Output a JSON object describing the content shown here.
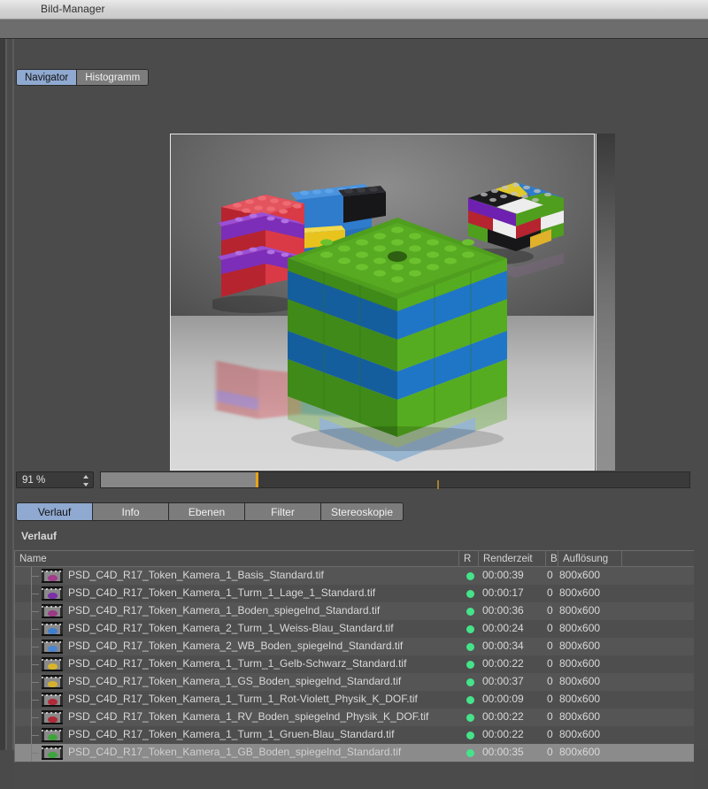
{
  "window": {
    "title": "Bild-Manager"
  },
  "top_tabs": [
    {
      "label": "Navigator",
      "active": true
    },
    {
      "label": "Histogramm",
      "active": false
    }
  ],
  "preview": {
    "name": "rendered-image-preview",
    "description": "3D render of LEGO brick structures on a reflective floor"
  },
  "zoom_control": {
    "value": "91 %",
    "slider_percent": 26
  },
  "bottom_tabs": [
    {
      "label": "Verlauf",
      "active": true
    },
    {
      "label": "Info",
      "active": false
    },
    {
      "label": "Ebenen",
      "active": false
    },
    {
      "label": "Filter",
      "active": false
    },
    {
      "label": "Stereoskopie",
      "active": false
    }
  ],
  "section": {
    "title": "Verlauf"
  },
  "table": {
    "columns": [
      "Name",
      "R",
      "Renderzeit",
      "B",
      "Auflösung"
    ],
    "rows": [
      {
        "name": "PSD_C4D_R17_Token_Kamera_1_Basis_Standard.tif",
        "r": "ok",
        "time": "00:00:39",
        "b": "0",
        "res": "800x600",
        "thumb": "#a23c8c",
        "selected": false
      },
      {
        "name": "PSD_C4D_R17_Token_Kamera_1_Turm_1_Lage_1_Standard.tif",
        "r": "ok",
        "time": "00:00:17",
        "b": "0",
        "res": "800x600",
        "thumb": "#7b2fa8",
        "selected": false
      },
      {
        "name": "PSD_C4D_R17_Token_Kamera_1_Boden_spiegelnd_Standard.tif",
        "r": "ok",
        "time": "00:00:36",
        "b": "0",
        "res": "800x600",
        "thumb": "#9b3a86",
        "selected": false
      },
      {
        "name": "PSD_C4D_R17_Token_Kamera_2_Turm_1_Weiss-Blau_Standard.tif",
        "r": "ok",
        "time": "00:00:24",
        "b": "0",
        "res": "800x600",
        "thumb": "#3f7fd0",
        "selected": false
      },
      {
        "name": "PSD_C4D_R17_Token_Kamera_2_WB_Boden_spiegelnd_Standard.tif",
        "r": "ok",
        "time": "00:00:34",
        "b": "0",
        "res": "800x600",
        "thumb": "#4a86cf",
        "selected": false
      },
      {
        "name": "PSD_C4D_R17_Token_Kamera_1_Turm_1_Gelb-Schwarz_Standard.tif",
        "r": "ok",
        "time": "00:00:22",
        "b": "0",
        "res": "800x600",
        "thumb": "#d8b52a",
        "selected": false
      },
      {
        "name": "PSD_C4D_R17_Token_Kamera_1_GS_Boden_spiegelnd_Standard.tif",
        "r": "ok",
        "time": "00:00:37",
        "b": "0",
        "res": "800x600",
        "thumb": "#d4b02c",
        "selected": false
      },
      {
        "name": "PSD_C4D_R17_Token_Kamera_1_Turm_1_Rot-Violett_Physik_K_DOF.tif",
        "r": "ok",
        "time": "00:00:09",
        "b": "0",
        "res": "800x600",
        "thumb": "#b02a3a",
        "selected": false
      },
      {
        "name": "PSD_C4D_R17_Token_Kamera_1_RV_Boden_spiegelnd_Physik_K_DOF.tif",
        "r": "ok",
        "time": "00:00:22",
        "b": "0",
        "res": "800x600",
        "thumb": "#ad2a38",
        "selected": false
      },
      {
        "name": "PSD_C4D_R17_Token_Kamera_1_Turm_1_Gruen-Blau_Standard.tif",
        "r": "ok",
        "time": "00:00:22",
        "b": "0",
        "res": "800x600",
        "thumb": "#3fa33c",
        "selected": false
      },
      {
        "name": "PSD_C4D_R17_Token_Kamera_1_GB_Boden_spiegelnd_Standard.tif",
        "r": "ok",
        "time": "00:00:35",
        "b": "0",
        "res": "800x600",
        "thumb": "#3ea53e",
        "selected": true
      }
    ]
  },
  "colors": {
    "accent_tab": "#8fa9d0",
    "status_ok": "#45e38a",
    "slider_knob": "#e8a317",
    "panel_bg": "#4b4b4b"
  }
}
